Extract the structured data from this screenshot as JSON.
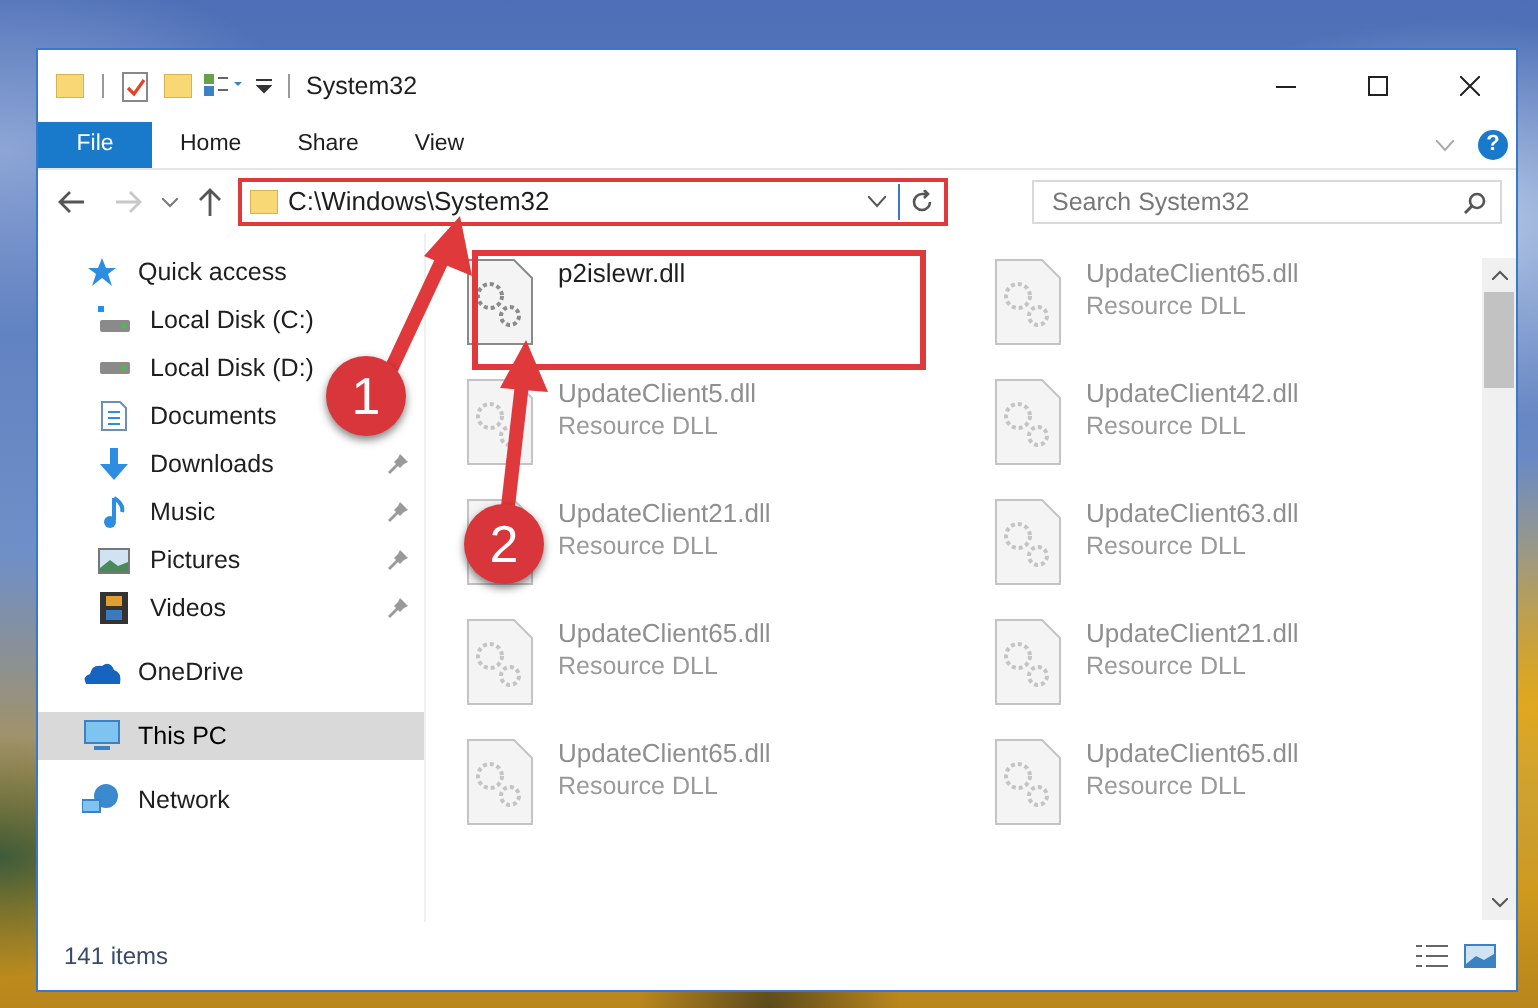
{
  "window": {
    "title": "System32"
  },
  "ribbon_tabs": [
    {
      "label": "File",
      "selected": true
    },
    {
      "label": "Home",
      "selected": false
    },
    {
      "label": "Share",
      "selected": false
    },
    {
      "label": "View",
      "selected": false
    }
  ],
  "help": {
    "label": "?"
  },
  "address": {
    "path": "C:\\Windows\\System32"
  },
  "search": {
    "placeholder": "Search System32"
  },
  "sidebar": {
    "items": [
      {
        "label": "Quick access",
        "selected": false,
        "children": [
          {
            "label": "Local Disk (C:)",
            "pinned": false,
            "selected": false
          },
          {
            "label": "Local Disk (D:)",
            "pinned": false,
            "selected": false
          },
          {
            "label": "Documents",
            "pinned": false,
            "selected": false
          },
          {
            "label": "Downloads",
            "pinned": true,
            "selected": false
          },
          {
            "label": "Music",
            "pinned": true,
            "selected": false
          },
          {
            "label": "Pictures",
            "pinned": true,
            "selected": false
          },
          {
            "label": "Videos",
            "pinned": true,
            "selected": false
          }
        ]
      },
      {
        "label": "OneDrive",
        "selected": false
      },
      {
        "label": "This PC",
        "selected": true
      },
      {
        "label": "Network",
        "selected": false
      }
    ]
  },
  "files": [
    {
      "name": "p2islewr.dll",
      "faded": false
    },
    {
      "name": "UpdateClient65.dll",
      "type": "Resource DLL",
      "faded": true
    },
    {
      "name": "UpdateClient5.dll",
      "type": "Resource DLL",
      "faded": true
    },
    {
      "name": "UpdateClient42.dll",
      "type": "Resource DLL",
      "faded": true
    },
    {
      "name": "UpdateClient21.dll",
      "type": "Resource DLL",
      "faded": true
    },
    {
      "name": "UpdateClient63.dll",
      "type": "Resource DLL",
      "faded": true
    },
    {
      "name": "UpdateClient65.dll",
      "type": "Resource DLL",
      "faded": true
    },
    {
      "name": "UpdateClient21.dll",
      "type": "Resource DLL",
      "faded": true
    },
    {
      "name": "UpdateClient65.dll",
      "type": "Resource DLL",
      "faded": true
    },
    {
      "name": "UpdateClient65.dll",
      "type": "Resource DLL",
      "faded": true
    }
  ],
  "status_bar": {
    "count": "141 items"
  },
  "annotations": [
    {
      "number": "1"
    },
    {
      "number": "2"
    }
  ]
}
